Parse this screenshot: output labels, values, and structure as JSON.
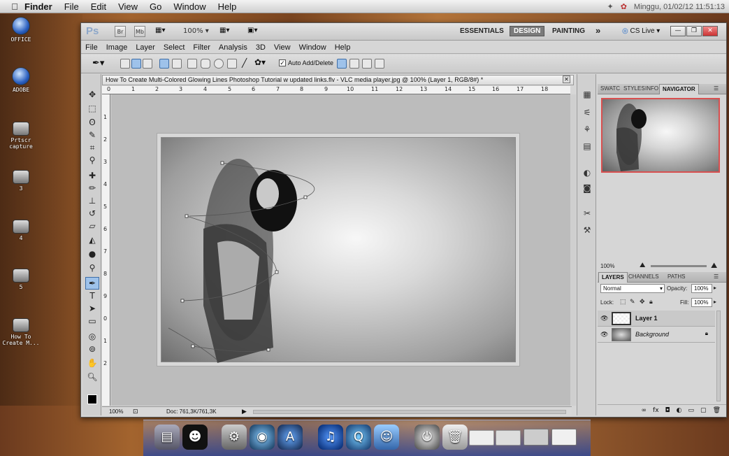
{
  "menubar": {
    "apple_icon": "apple-icon",
    "app": "Finder",
    "items": [
      "File",
      "Edit",
      "View",
      "Go",
      "Window",
      "Help"
    ],
    "right_text": "Minggu, 01/02/12 11:51:13"
  },
  "desktop": {
    "icons": [
      {
        "label": "OFFICE",
        "icon": "office-icon"
      },
      {
        "label": "ADOBE",
        "icon": "adobe-icon"
      },
      {
        "label": "Prtscr capture",
        "icon": "document-icon"
      },
      {
        "label": "3",
        "icon": "document-icon"
      },
      {
        "label": "4",
        "icon": "document-icon"
      },
      {
        "label": "5",
        "icon": "document-icon"
      },
      {
        "label": "How To Create M...",
        "icon": "document-icon"
      }
    ]
  },
  "photoshop": {
    "logo": "Ps",
    "bridge_btn": "Br",
    "mini_bridge_btn": "Mb",
    "zoom_select": "100%",
    "workspaces": {
      "essentials": "ESSENTIALS",
      "design": "DESIGN",
      "painting": "PAINTING",
      "more": "»"
    },
    "cs_live": "CS Live",
    "menu": [
      "File",
      "Image",
      "Layer",
      "Select",
      "Filter",
      "Analysis",
      "3D",
      "View",
      "Window",
      "Help"
    ],
    "options": {
      "auto_add_delete": "Auto Add/Delete",
      "auto_add_checked": true
    },
    "document": {
      "tab_title": "How To Create Multi-Colored Glowing Lines Photoshop Tutorial w updated links.flv - VLC media player.jpg @ 100% (Layer 1, RGB/8#) *",
      "ruler_h": [
        "0",
        "1",
        "2",
        "3",
        "4",
        "5",
        "6",
        "7",
        "8",
        "9",
        "10",
        "11",
        "12",
        "13",
        "14",
        "15",
        "16",
        "17",
        "18"
      ],
      "ruler_v": [
        "1",
        "2",
        "3",
        "4",
        "5",
        "6",
        "7",
        "8",
        "9",
        "0",
        "1",
        "2"
      ],
      "zoom": "100%",
      "doc_size": "Doc: 761,3K/761,3K"
    },
    "navigator": {
      "tabs": [
        "SWATC",
        "STYLES",
        "INFO",
        "NAVIGATOR"
      ],
      "active_tab": "NAVIGATOR",
      "zoom": "100%"
    },
    "layers": {
      "tabs": [
        "LAYERS",
        "CHANNELS",
        "PATHS"
      ],
      "active_tab": "LAYERS",
      "blend_mode": "Normal",
      "opacity_label": "Opacity:",
      "opacity": "100%",
      "lock_label": "Lock:",
      "fill_label": "Fill:",
      "fill": "100%",
      "items": [
        {
          "name": "Layer 1",
          "selected": true
        },
        {
          "name": "Background",
          "selected": false,
          "locked": true
        }
      ]
    }
  },
  "dock": {
    "items": [
      "finder-icon",
      "steve-jobs-icon",
      "system-prefs-icon",
      "safari-icon",
      "app-store-icon",
      "itunes-icon",
      "quicktime-icon",
      "finder-face-icon",
      "power-icon",
      "trash-icon",
      "window-thumb-icon",
      "window-thumb-icon",
      "window-thumb-icon",
      "window-thumb-icon"
    ]
  }
}
